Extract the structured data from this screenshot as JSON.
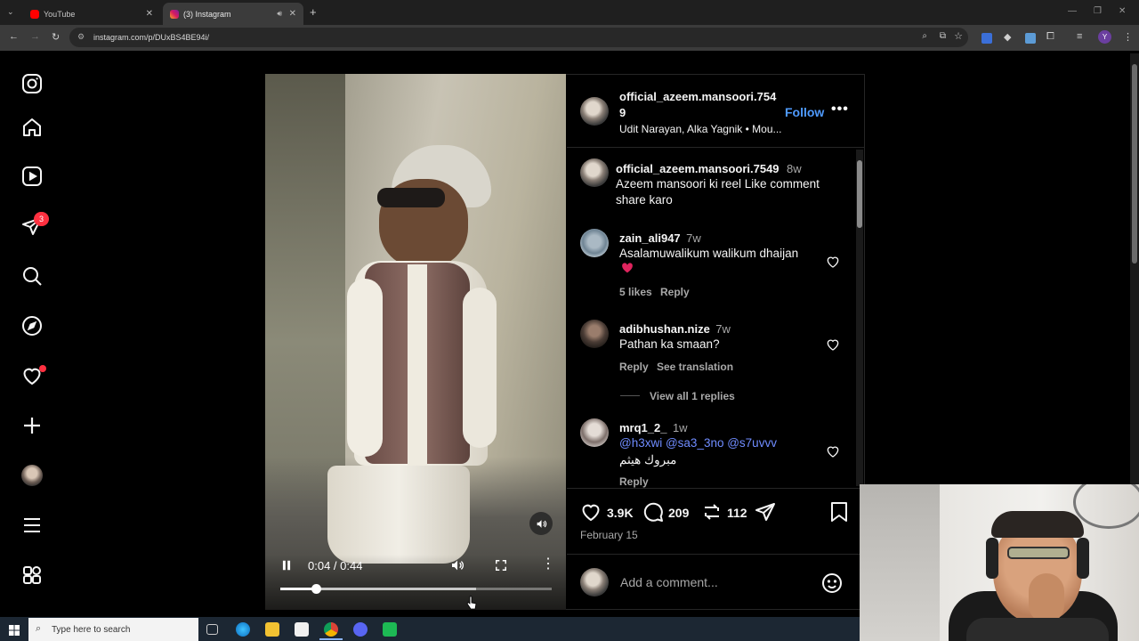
{
  "browser": {
    "tabs": [
      {
        "title": "YouTube",
        "active": false
      },
      {
        "title": "(3) Instagram",
        "active": true
      }
    ],
    "new_tab": "+",
    "url": "instagram.com/p/DUxBS4BE94i/"
  },
  "sidebar": {
    "notification_count": "3"
  },
  "post": {
    "header": {
      "username_line1": "official_azeem.mansoori.754",
      "username_line2": "9",
      "follow_label": "Follow",
      "audio": "Udit Narayan, Alka Yagnik • Mou..."
    },
    "caption": {
      "username": "official_azeem.mansoori.7549",
      "age": "8w",
      "text_line1": "Azeem mansoori ki reel Like comment",
      "text_line2": "share karo"
    },
    "comments": [
      {
        "username": "zain_ali947",
        "age": "7w",
        "text": "Asalamuwalikum walikum dhaijan",
        "likes": "5 likes",
        "reply": "Reply"
      },
      {
        "username": "adibhushan.nize",
        "age": "7w",
        "text": "Pathan ka smaan?",
        "reply": "Reply",
        "translate": "See translation",
        "view_replies": "View all 1 replies"
      },
      {
        "username": "mrq1_2_",
        "age": "1w",
        "mentions": "@h3xwi @sa3_3no @s7uvvv",
        "text": "مبروك هيثم",
        "reply": "Reply"
      }
    ],
    "actions": {
      "likes": "3.9K",
      "comments": "209",
      "reposts": "112"
    },
    "date": "February 15",
    "add_comment_placeholder": "Add a comment..."
  },
  "video": {
    "time": "0:04 / 0:44",
    "progress": 0.13,
    "buffered": 0.72
  },
  "taskbar": {
    "search_placeholder": "Type here to search"
  },
  "colors": {
    "accent_blue": "#4a5df9",
    "follow_blue": "#4f9bff",
    "badge_red": "#ff3040"
  }
}
